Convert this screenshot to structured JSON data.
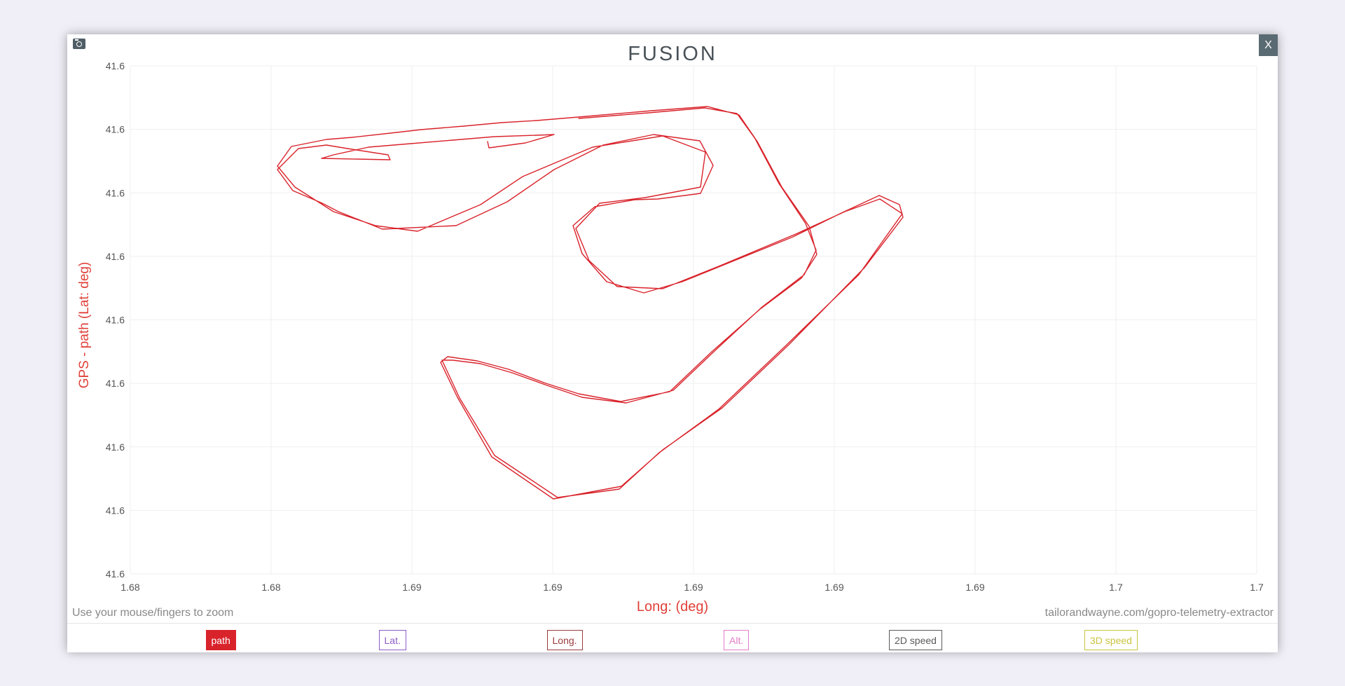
{
  "modal": {
    "title": "FUSION",
    "close_label": "X",
    "hint": "Use your mouse/fingers to zoom",
    "credit": "tailorandwayne.com/gopro-telemetry-extractor"
  },
  "legend": [
    {
      "label": "path",
      "color": "#d9232b",
      "active": true
    },
    {
      "label": "Lat.",
      "color": "#8e5cc8",
      "active": false
    },
    {
      "label": "Long.",
      "color": "#9b3a3a",
      "active": false
    },
    {
      "label": "Alt.",
      "color": "#e37dc8",
      "active": false
    },
    {
      "label": "2D speed",
      "color": "#5a5a5a",
      "active": false
    },
    {
      "label": "3D speed",
      "color": "#c9c340",
      "active": false
    }
  ],
  "chart_data": {
    "type": "line",
    "title": "FUSION",
    "xlabel": "Long: (deg)",
    "ylabel": "GPS - path (Lat: deg)",
    "x_tick_labels": [
      "1.68",
      "1.68",
      "1.69",
      "1.69",
      "1.69",
      "1.69",
      "1.69",
      "1.7",
      "1.7"
    ],
    "y_tick_labels": [
      "41.6",
      "41.6",
      "41.6",
      "41.6",
      "41.6",
      "41.6",
      "41.6",
      "41.6",
      "41.6"
    ],
    "xlim": [
      1.68,
      1.7
    ],
    "ylim": [
      41.6,
      41.6
    ],
    "grid": true,
    "series": [
      {
        "name": "path",
        "color": "#d9232b",
        "x": [
          1.6924,
          1.6925,
          1.6945,
          1.6965,
          1.6978,
          1.6985,
          1.6989,
          1.6986,
          1.6968,
          1.6938,
          1.6916,
          1.6896,
          1.6885,
          1.687,
          1.6856,
          1.6844,
          1.6822,
          1.6814,
          1.6826,
          1.6846,
          1.6864,
          1.6874,
          1.687,
          1.6858,
          1.6842,
          1.683,
          1.6817,
          1.6814,
          1.6825,
          1.6857,
          1.6885,
          1.69,
          1.6918,
          1.6935,
          1.695,
          1.697,
          1.6984,
          1.6986,
          1.696,
          1.6935,
          1.6918,
          1.6905,
          1.6893,
          1.6876,
          1.6862,
          1.6852,
          1.683,
          1.6813,
          1.6801,
          1.6789,
          1.6784,
          1.6803,
          1.6827,
          1.6848,
          1.6861,
          1.6867,
          1.6863,
          1.6855,
          1.685,
          1.6848,
          1.685,
          1.6862
        ],
        "y": [
          41.6,
          41.6,
          41.6,
          41.6,
          41.6,
          41.6,
          41.6,
          41.6,
          41.6,
          41.6,
          41.6,
          41.6,
          41.6,
          41.6,
          41.6,
          41.6,
          41.6,
          41.6,
          41.6,
          41.6,
          41.6,
          41.6,
          41.6,
          41.6,
          41.6,
          41.6,
          41.6,
          41.6,
          41.6,
          41.6,
          41.6,
          41.6,
          41.6,
          41.6,
          41.6,
          41.6,
          41.6,
          41.6,
          41.6,
          41.6,
          41.6,
          41.6,
          41.6,
          41.6,
          41.6,
          41.6,
          41.6,
          41.6,
          41.6,
          41.6,
          41.6,
          41.6,
          41.6,
          41.6,
          41.6,
          41.6,
          41.6,
          41.6,
          41.6,
          41.6,
          41.6,
          41.6
        ]
      }
    ]
  }
}
